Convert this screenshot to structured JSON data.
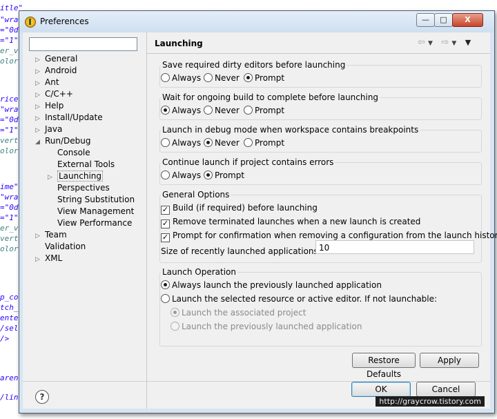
{
  "background_code": [
    {
      "text": "itle\"",
      "cls": ""
    },
    {
      "text": "\"wra",
      "cls": ""
    },
    {
      "text": "=\"0d",
      "cls": ""
    },
    {
      "text": "=\"1\"",
      "cls": ""
    },
    {
      "text": "er_v",
      "cls": "blk"
    },
    {
      "text": "olor",
      "cls": "blk"
    },
    {
      "text": "rice",
      "cls": ""
    },
    {
      "text": "\"wra",
      "cls": ""
    },
    {
      "text": "=\"0d",
      "cls": ""
    },
    {
      "text": "=\"1\"",
      "cls": ""
    },
    {
      "text": "vert",
      "cls": "blk"
    },
    {
      "text": "olor",
      "cls": "blk"
    },
    {
      "text": "ime\"",
      "cls": ""
    },
    {
      "text": "\"wra",
      "cls": ""
    },
    {
      "text": "=\"0d",
      "cls": ""
    },
    {
      "text": "=\"1\"",
      "cls": ""
    },
    {
      "text": "er_v",
      "cls": "blk"
    },
    {
      "text": "vert",
      "cls": "blk"
    },
    {
      "text": "olor",
      "cls": "blk"
    },
    {
      "text": "p_co",
      "cls": ""
    },
    {
      "text": "tch_",
      "cls": ""
    },
    {
      "text": "ente",
      "cls": ""
    },
    {
      "text": "/sel",
      "cls": ""
    },
    {
      "text": " />",
      "cls": ""
    },
    {
      "text": "aren",
      "cls": ""
    },
    {
      "text": "/lin",
      "cls": ""
    }
  ],
  "window": {
    "title": "Preferences",
    "minimize_label": "—",
    "maximize_label": "□",
    "close_label": "X"
  },
  "sidebar": {
    "filter_value": "",
    "items": [
      {
        "label": "General",
        "expander": "▷",
        "level": 0
      },
      {
        "label": "Android",
        "expander": "▷",
        "level": 0
      },
      {
        "label": "Ant",
        "expander": "▷",
        "level": 0
      },
      {
        "label": "C/C++",
        "expander": "▷",
        "level": 0
      },
      {
        "label": "Help",
        "expander": "▷",
        "level": 0
      },
      {
        "label": "Install/Update",
        "expander": "▷",
        "level": 0
      },
      {
        "label": "Java",
        "expander": "▷",
        "level": 0
      },
      {
        "label": "Run/Debug",
        "expander": "◢",
        "level": 0
      },
      {
        "label": "Console",
        "expander": "",
        "level": 1
      },
      {
        "label": "External Tools",
        "expander": "",
        "level": 1
      },
      {
        "label": "Launching",
        "expander": "▷",
        "level": 1,
        "selected": true
      },
      {
        "label": "Perspectives",
        "expander": "",
        "level": 1
      },
      {
        "label": "String Substitution",
        "expander": "",
        "level": 1
      },
      {
        "label": "View Management",
        "expander": "",
        "level": 1
      },
      {
        "label": "View Performance",
        "expander": "",
        "level": 1
      },
      {
        "label": "Team",
        "expander": "▷",
        "level": 0
      },
      {
        "label": "Validation",
        "expander": "",
        "level": 0
      },
      {
        "label": "XML",
        "expander": "▷",
        "level": 0
      }
    ]
  },
  "page": {
    "title": "Launching",
    "back_icon": "⇦",
    "forward_icon": "⇨",
    "dropdown_icon": "▼",
    "menu_icon": "▼"
  },
  "groups": {
    "save_dirty": {
      "legend": "Save required dirty editors before launching",
      "options": [
        "Always",
        "Never",
        "Prompt"
      ],
      "selected": "Prompt"
    },
    "wait_build": {
      "legend": "Wait for ongoing build to complete before launching",
      "options": [
        "Always",
        "Never",
        "Prompt"
      ],
      "selected": "Always"
    },
    "debug_mode": {
      "legend": "Launch in debug mode when workspace contains breakpoints",
      "options": [
        "Always",
        "Never",
        "Prompt"
      ],
      "selected": "Never"
    },
    "continue_errors": {
      "legend": "Continue launch if project contains errors",
      "options": [
        "Always",
        "Prompt"
      ],
      "selected": "Prompt"
    },
    "general_options": {
      "legend": "General Options",
      "checkboxes": [
        {
          "label": "Build (if required) before launching",
          "checked": true
        },
        {
          "label": "Remove terminated launches when a new launch is created",
          "checked": true
        },
        {
          "label": "Prompt for confirmation when removing a configuration from the launch history",
          "checked": true
        }
      ],
      "history_size_label": "Size of recently launched applications list:",
      "history_size_value": "10"
    },
    "launch_operation": {
      "legend": "Launch Operation",
      "option_previous": "Always launch the previously launched application",
      "option_selected": "Launch the selected resource or active editor. If not launchable:",
      "sub_associated": "Launch the associated project",
      "sub_previous": "Launch the previously launched application",
      "selected": "previous",
      "sub_selected": "associated"
    }
  },
  "buttons": {
    "restore_defaults": "Restore Defaults",
    "apply": "Apply",
    "ok": "OK",
    "cancel": "Cancel",
    "help": "?"
  },
  "watermark": "http://graycrow.tistory.com"
}
